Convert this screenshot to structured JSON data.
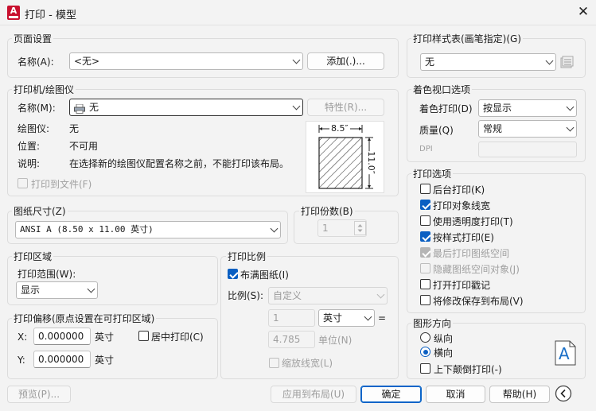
{
  "window": {
    "title": "打印 - 模型",
    "app_icon_letter": "A"
  },
  "page_setup": {
    "title": "页面设置",
    "name_label": "名称(A):",
    "name_value": "<无>",
    "add_button": "添加(.)..."
  },
  "printer": {
    "title": "打印机/绘图仪",
    "name_label": "名称(M):",
    "name_value": "无",
    "properties_button": "特性(R)...",
    "plotter_label": "绘图仪:",
    "plotter_value": "无",
    "location_label": "位置:",
    "location_value": "不可用",
    "description_label": "说明:",
    "description_value": "在选择新的绘图仪配置名称之前，不能打印该布局。",
    "print_to_file": "打印到文件(F)",
    "preview_width": "8.5″",
    "preview_height": "11.0″"
  },
  "paper_size": {
    "title": "图纸尺寸(Z)",
    "value": "ANSI A (8.50 x 11.00 英寸)"
  },
  "copies": {
    "title": "打印份数(B)",
    "value": "1"
  },
  "print_area": {
    "title": "打印区域",
    "range_label": "打印范围(W):",
    "range_value": "显示"
  },
  "print_offset": {
    "title": "打印偏移(原点设置在可打印区域)",
    "x_label": "X:",
    "x_value": "0.000000",
    "x_unit": "英寸",
    "y_label": "Y:",
    "y_value": "0.000000",
    "y_unit": "英寸",
    "center": "居中打印(C)"
  },
  "print_scale": {
    "title": "打印比例",
    "fit_paper": "布满图纸(I)",
    "scale_label": "比例(S):",
    "scale_value": "自定义",
    "scale_num": "1",
    "unit_value": "英寸",
    "equals": "=",
    "scale_den": "4.785",
    "unit_label": "单位(N)",
    "scale_lineweights": "缩放线宽(L)"
  },
  "plot_style": {
    "title": "打印样式表(画笔指定)(G)",
    "value": "无"
  },
  "shaded_viewport": {
    "title": "着色视口选项",
    "shade_label": "着色打印(D)",
    "shade_value": "按显示",
    "quality_label": "质量(Q)",
    "quality_value": "常规",
    "dpi_label": "DPI"
  },
  "print_options": {
    "title": "打印选项",
    "items": [
      {
        "label": "后台打印(K)",
        "checked": false,
        "disabled": false
      },
      {
        "label": "打印对象线宽",
        "checked": true,
        "disabled": false
      },
      {
        "label": "使用透明度打印(T)",
        "checked": false,
        "disabled": false
      },
      {
        "label": "按样式打印(E)",
        "checked": true,
        "disabled": false
      },
      {
        "label": "最后打印图纸空间",
        "checked": true,
        "disabled": true
      },
      {
        "label": "隐藏图纸空间对象(J)",
        "checked": false,
        "disabled": true
      },
      {
        "label": "打开打印戳记",
        "checked": false,
        "disabled": false
      },
      {
        "label": "将修改保存到布局(V)",
        "checked": false,
        "disabled": false
      }
    ]
  },
  "orientation": {
    "title": "图形方向",
    "portrait": "纵向",
    "landscape": "横向",
    "upside_down": "上下颠倒打印(-)",
    "icon_letter": "A"
  },
  "footer": {
    "preview": "预览(P)...",
    "apply_layout": "应用到布局(U)",
    "ok": "确定",
    "cancel": "取消",
    "help": "帮助(H)"
  },
  "colors": {
    "accent": "#0a5fc2",
    "app_icon": "#c8102e"
  }
}
